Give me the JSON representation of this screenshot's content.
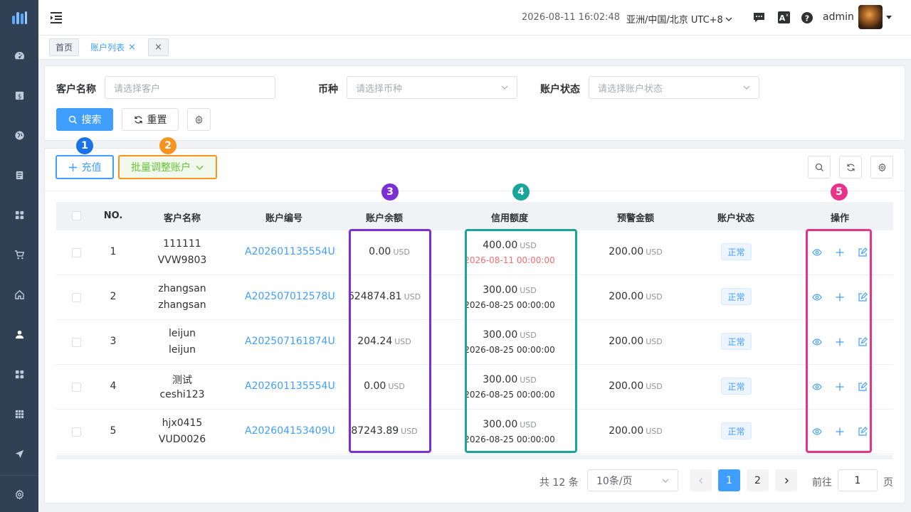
{
  "header": {
    "datetime": "2026-08-11 16:02:48",
    "timezone": "亚洲/中国/北京 UTC+8",
    "username": "admin"
  },
  "tags": [
    {
      "label": "首页"
    },
    {
      "label": "账户列表",
      "close": "×"
    },
    {
      "close": "×"
    }
  ],
  "filters": {
    "customer_label": "客户名称",
    "customer_placeholder": "请选择客户",
    "currency_label": "币种",
    "currency_placeholder": "请选择币种",
    "status_label": "账户状态",
    "status_placeholder": "请选择账户状态",
    "search_label": "搜索",
    "reset_label": "重置"
  },
  "toolbar": {
    "recharge_label": "充值",
    "batch_adjust_label": "批量调整账户"
  },
  "markers": [
    "1",
    "2",
    "3",
    "4",
    "5"
  ],
  "table": {
    "columns": [
      "NO.",
      "客户名称",
      "账户编号",
      "账户余额",
      "信用额度",
      "预警金额",
      "账户状态",
      "操作"
    ],
    "rows": [
      {
        "no": "1",
        "name1": "111111",
        "name2": "VVW9803",
        "account": "A202601135554USD",
        "balance": "0.00",
        "balance_unit": "USD",
        "credit": "400.00",
        "credit_unit": "USD",
        "credit_date": "2026-08-11 00:00:00",
        "credit_date_expired": true,
        "warning": "200.00",
        "warning_unit": "USD",
        "status": "正常"
      },
      {
        "no": "2",
        "name1": "zhangsan",
        "name2": "zhangsan",
        "account": "A202507012578USD",
        "balance": "624874.81",
        "balance_unit": "USD",
        "credit": "300.00",
        "credit_unit": "USD",
        "credit_date": "2026-08-25 00:00:00",
        "credit_date_expired": false,
        "warning": "200.00",
        "warning_unit": "USD",
        "status": "正常"
      },
      {
        "no": "3",
        "name1": "leijun",
        "name2": "leijun",
        "account": "A202507161874USD",
        "balance": "204.24",
        "balance_unit": "USD",
        "credit": "300.00",
        "credit_unit": "USD",
        "credit_date": "2026-08-25 00:00:00",
        "credit_date_expired": false,
        "warning": "200.00",
        "warning_unit": "USD",
        "status": "正常"
      },
      {
        "no": "4",
        "name1": "测试",
        "name2": "ceshi123",
        "account": "A202601135554USD",
        "balance": "0.00",
        "balance_unit": "USD",
        "credit": "300.00",
        "credit_unit": "USD",
        "credit_date": "2026-08-25 00:00:00",
        "credit_date_expired": false,
        "warning": "200.00",
        "warning_unit": "USD",
        "status": "正常"
      },
      {
        "no": "5",
        "name1": "hjx0415",
        "name2": "VUD0026",
        "account": "A202604153409USD",
        "balance": "87243.89",
        "balance_unit": "USD",
        "credit": "300.00",
        "credit_unit": "USD",
        "credit_date": "2026-08-25 00:00:00",
        "credit_date_expired": false,
        "warning": "200.00",
        "warning_unit": "USD",
        "status": "正常"
      }
    ]
  },
  "pagination": {
    "total": "共 12 条",
    "page_size": "10条/页",
    "pages": [
      "1",
      "2"
    ],
    "current": "1",
    "goto_label": "前往",
    "goto_value": "1",
    "page_suffix": "页"
  },
  "colors": {
    "primary": "#409eff",
    "sidebar": "#304156",
    "marker1": "#1a73e8",
    "marker2": "#f7931e",
    "marker3": "#7b2fd4",
    "marker4": "#1aa59a",
    "marker5": "#e8338a",
    "expired_date": "#f56c6c"
  }
}
